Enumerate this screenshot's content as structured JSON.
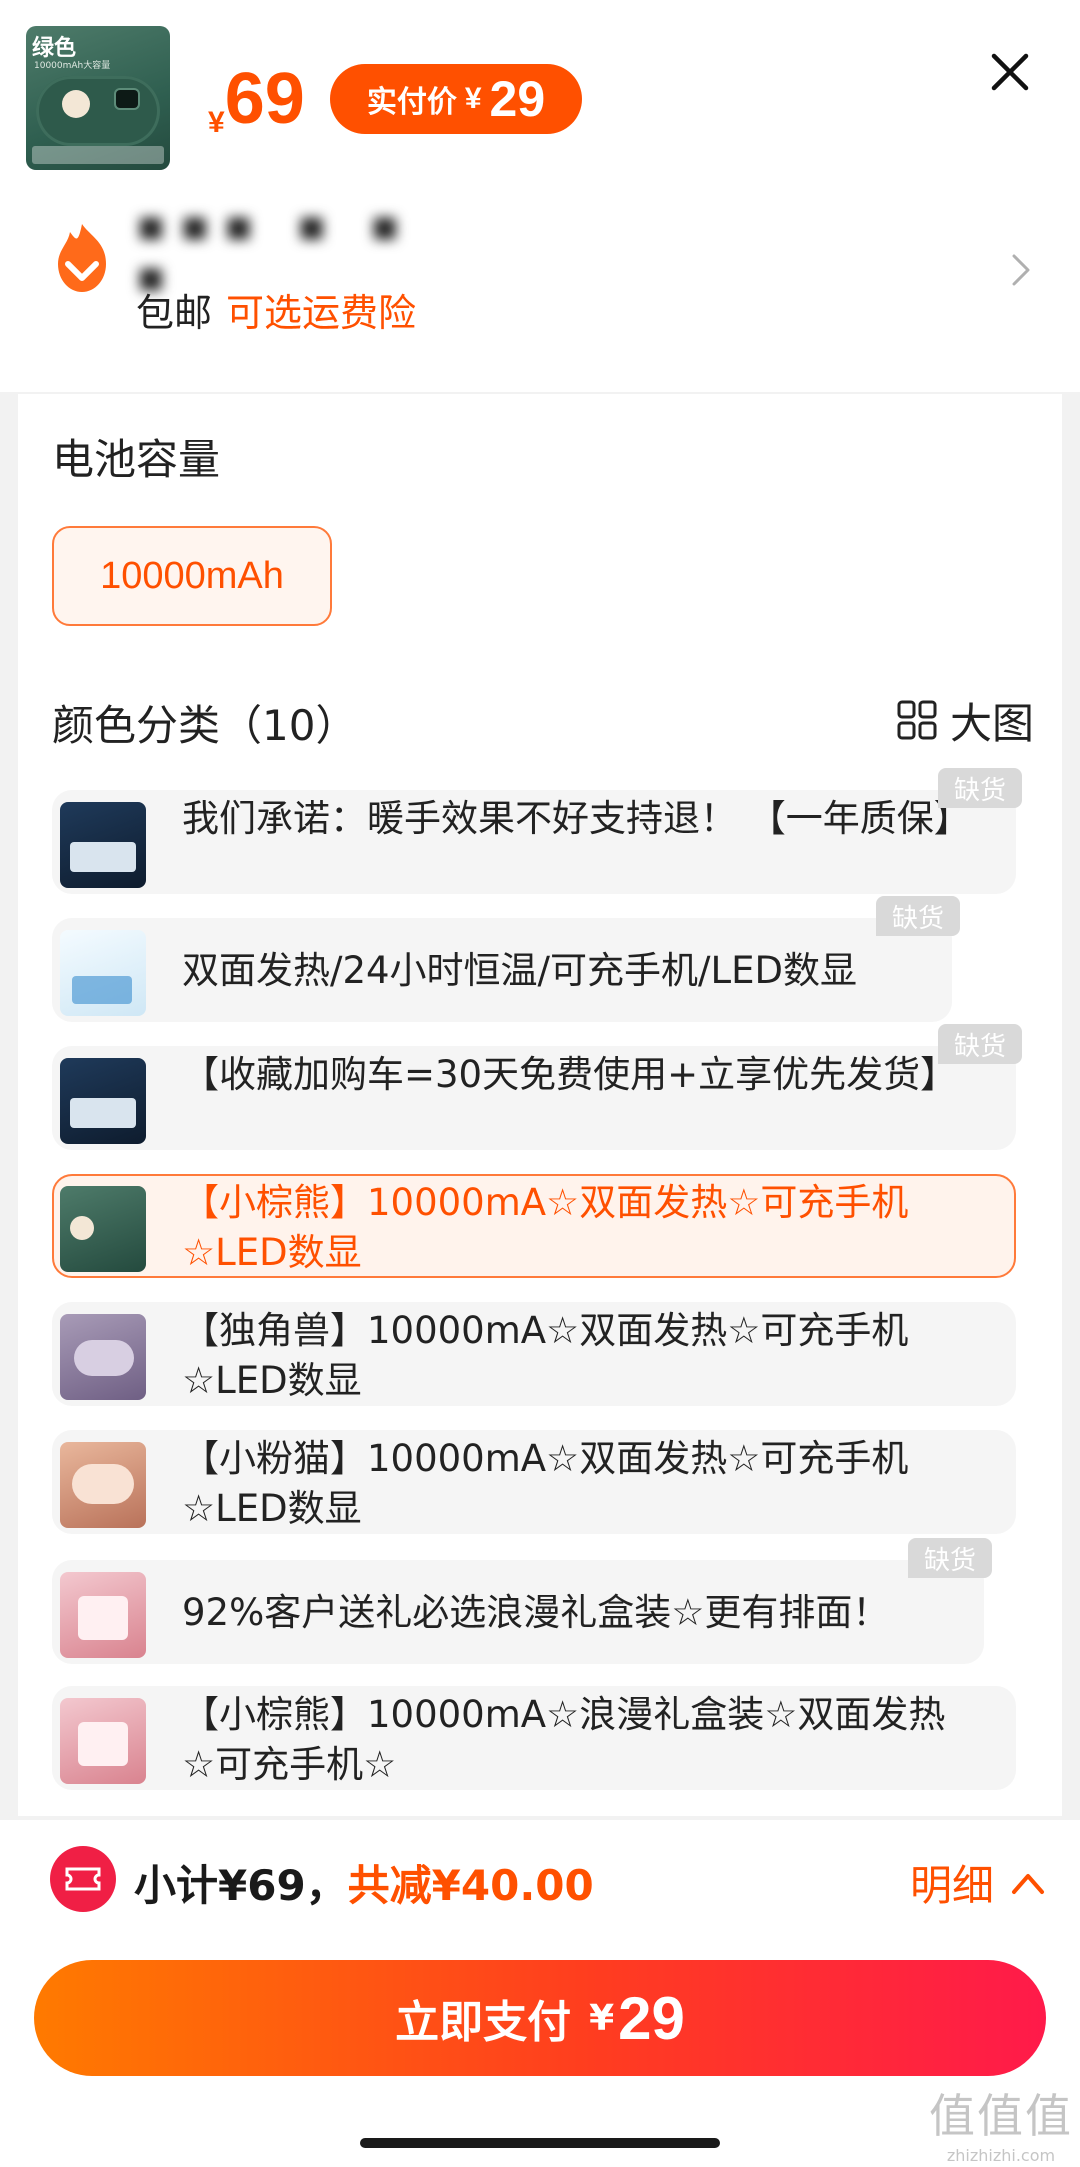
{
  "product": {
    "thumb_tag": "绿色",
    "thumb_sub": "10000mAh大容量",
    "price_symbol": "¥",
    "price": "69",
    "actual_label": "实付价",
    "actual_symbol": "¥",
    "actual_price": "29"
  },
  "shop": {
    "name": "▪▪▪ ▪ ▪ ▪",
    "shipping_free": "包邮",
    "shipping_insurance": "可选运费险"
  },
  "spec": {
    "capacity_title": "电池容量",
    "capacity_option": "10000mAh",
    "color_title": "颜色分类（10）",
    "big_view_label": "大图"
  },
  "options": [
    {
      "label": "我们承诺：暖手效果不好支持退！ 【一年质保】",
      "out_of_stock": "缺货"
    },
    {
      "label": "双面发热/24小时恒温/可充手机/LED数显",
      "out_of_stock": "缺货"
    },
    {
      "label": "【收藏加购车=30天免费使用+立享优先发货】",
      "out_of_stock": "缺货"
    },
    {
      "label": "【小棕熊】10000mA☆双面发热☆可充手机☆LED数显",
      "out_of_stock": ""
    },
    {
      "label": "【独角兽】10000mA☆双面发热☆可充手机☆LED数显",
      "out_of_stock": ""
    },
    {
      "label": "【小粉猫】10000mA☆双面发热☆可充手机☆LED数显",
      "out_of_stock": ""
    },
    {
      "label": "92%客户送礼必选浪漫礼盒装☆更有排面！",
      "out_of_stock": "缺货"
    },
    {
      "label": "【小棕熊】10000mA☆浪漫礼盒装☆双面发热☆可充手机☆",
      "out_of_stock": ""
    }
  ],
  "footer": {
    "subtotal": "小计¥69，",
    "discount": "共减¥40.00",
    "detail": "明细",
    "pay_label": "立即支付",
    "pay_symbol": "¥",
    "pay_amount": "29"
  },
  "watermark": {
    "main": "值值值",
    "sub": "zhizhizhi.com"
  },
  "colors": {
    "accent": "#ff5000",
    "selected_bg": "#fff3ec",
    "option_bg": "#f5f5f5",
    "oos_badge": "#d9d9d9",
    "coupon_red": "#f01f45"
  }
}
